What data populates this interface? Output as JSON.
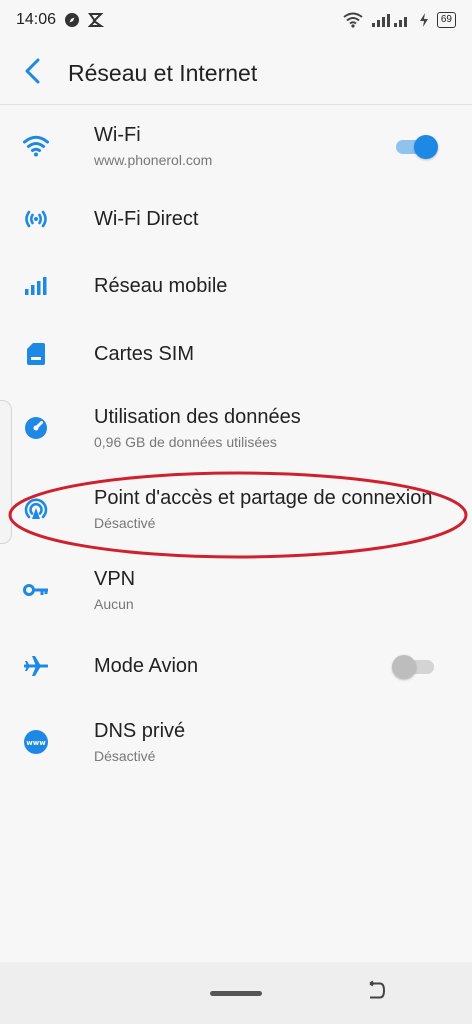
{
  "status_bar": {
    "time": "14:06",
    "battery": "69"
  },
  "header": {
    "title": "Réseau et Internet"
  },
  "items": [
    {
      "id": "wifi",
      "title": "Wi-Fi",
      "subtitle": "www.phonerol.com",
      "icon": "wifi-icon",
      "toggle": true
    },
    {
      "id": "wifi-direct",
      "title": "Wi-Fi Direct",
      "icon": "wifi-direct-icon"
    },
    {
      "id": "mobile-network",
      "title": "Réseau mobile",
      "icon": "signal-bars-icon"
    },
    {
      "id": "sim",
      "title": "Cartes SIM",
      "icon": "sim-card-icon"
    },
    {
      "id": "data-usage",
      "title": "Utilisation des données",
      "subtitle": "0,96 GB de données utilisées",
      "icon": "data-usage-icon"
    },
    {
      "id": "hotspot",
      "title": "Point d'accès et partage de connexion",
      "subtitle": "Désactivé",
      "icon": "hotspot-icon"
    },
    {
      "id": "vpn",
      "title": "VPN",
      "subtitle": "Aucun",
      "icon": "key-icon"
    },
    {
      "id": "airplane",
      "title": "Mode Avion",
      "icon": "airplane-icon",
      "toggle": false
    },
    {
      "id": "dns",
      "title": "DNS privé",
      "subtitle": "Désactivé",
      "icon": "www-icon"
    }
  ],
  "colors": {
    "accent": "#1e88e5",
    "annotation": "#d0202e",
    "background": "#f7f7f7"
  }
}
